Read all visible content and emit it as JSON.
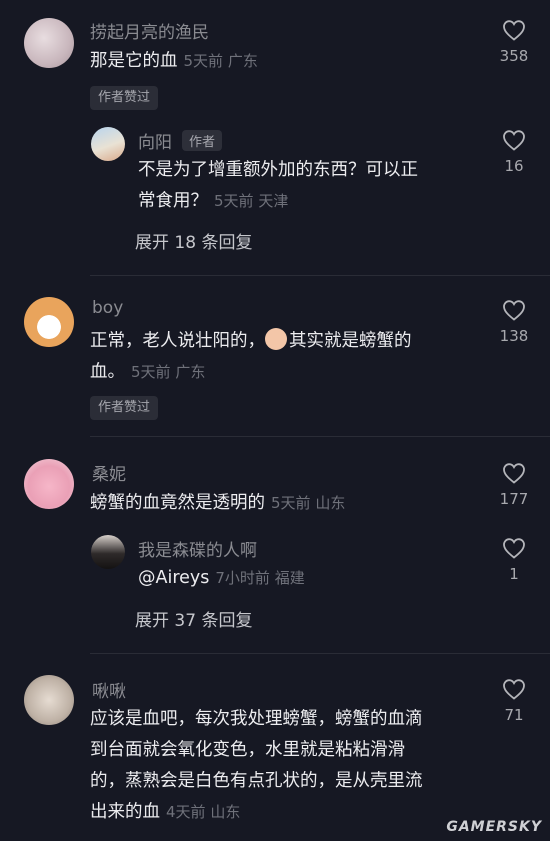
{
  "comments": [
    {
      "user": "捞起月亮的渔民",
      "text": "那是它的血",
      "time": "5天前",
      "location": "广东",
      "likes": "358",
      "badge": "作者赞过",
      "reply": {
        "user": "向阳",
        "author_tag": "作者",
        "line1": "不是为了增重额外加的东西？可以正",
        "line2": "常食用？",
        "time": "5天前",
        "location": "天津",
        "likes": "16"
      },
      "expand_label": "展开 18 条回复"
    },
    {
      "user": "boy",
      "line1a": "正常，老人说壮阳的，",
      "line1b": "其实就是螃蟹的",
      "line2": "血。",
      "time": "5天前",
      "location": "广东",
      "likes": "138",
      "badge": "作者赞过"
    },
    {
      "user": "桑妮",
      "text": "螃蟹的血竟然是透明的",
      "time": "5天前",
      "location": "山东",
      "likes": "177",
      "reply": {
        "user": "我是森碟的人啊",
        "text": "@Aireys",
        "time": "7小时前",
        "location": "福建",
        "likes": "1"
      },
      "expand_label": "展开 37 条回复"
    },
    {
      "user": "啾啾",
      "line1": "应该是血吧，每次我处理螃蟹，螃蟹的血滴",
      "line2": "到台面就会氧化变色，水里就是粘粘滑滑",
      "line3": "的，蒸熟会是白色有点孔状的，是从壳里流",
      "line4": "出来的血",
      "time": "4天前",
      "location": "山东",
      "likes": "71"
    }
  ],
  "watermark": "GAMERSKY",
  "colors": {
    "background": "#161823",
    "username": "#8a8b91",
    "text": "#ececef",
    "meta": "#6f717a"
  }
}
